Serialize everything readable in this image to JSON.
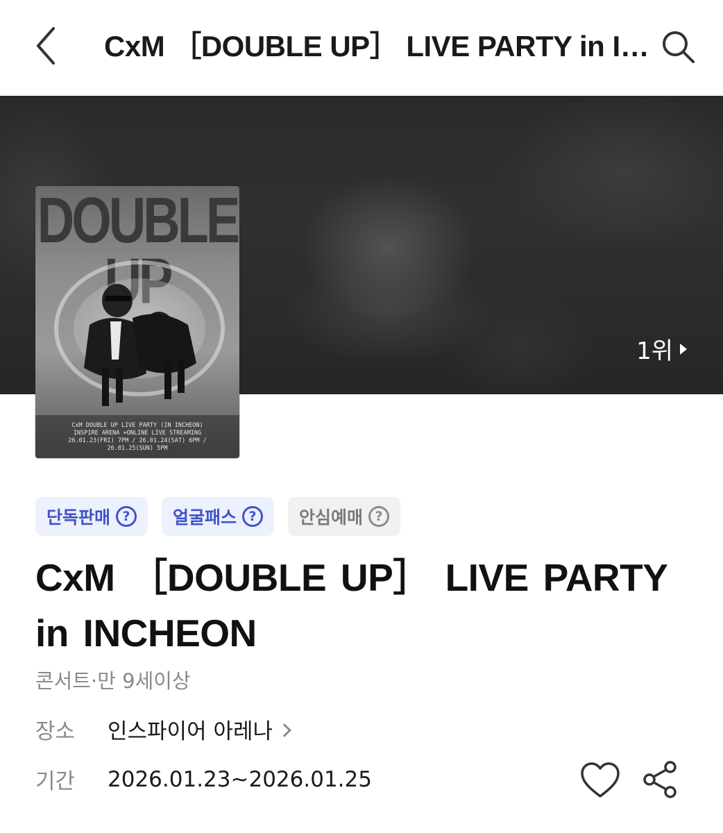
{
  "header": {
    "title": "CxM ［DOUBLE UP］ LIVE PARTY in INCHEON",
    "back_icon": "chevron-left-icon",
    "search_icon": "search-icon"
  },
  "banner": {
    "rank_label": "1위"
  },
  "poster": {
    "title": "DOUBLE UP",
    "caption_line1": "CxM DOUBLE UP LIVE PARTY (IN INCHEON)",
    "caption_line2": "INSPIRE ARENA +ONLINE LIVE STREAMING",
    "caption_line3": "26.01.23(FRI) 7PM / 26.01.24(SAT) 6PM / 26.01.25(SUN) 5PM"
  },
  "chips": [
    {
      "label": "단독판매",
      "icon": "help-circle-icon",
      "style": "blue"
    },
    {
      "label": "얼굴패스",
      "icon": "help-circle-icon",
      "style": "blue"
    },
    {
      "label": "안심예매",
      "icon": "help-circle-icon",
      "style": "gray"
    }
  ],
  "event": {
    "title": "CxM ［DOUBLE UP］ LIVE PARTY in INCHEON",
    "meta": "콘서트·만 9세이상",
    "venue_label": "장소",
    "venue_value": "인스파이어 아레나",
    "period_label": "기간",
    "period_value": "2026.01.23~2026.01.25"
  },
  "colors": {
    "chip_blue_bg": "#edf0fd",
    "chip_blue_text": "#3f53c8",
    "chip_gray_bg": "#f1f1f1",
    "muted_text": "#8a8a8a"
  }
}
